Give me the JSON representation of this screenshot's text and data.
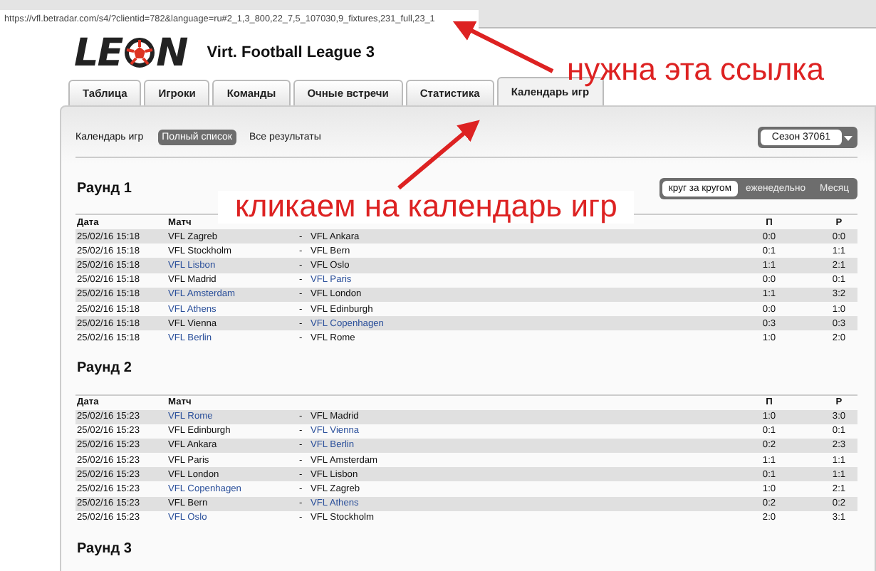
{
  "address_bar": {
    "url": "https://vfl.betradar.com/s4/?clientid=782&language=ru#2_1,3_800,22_7,5_107030,9_fixtures,231_full,23_1"
  },
  "header": {
    "logo_before": "LE",
    "logo_after": "N",
    "title": "Virt. Football League 3"
  },
  "tabs": [
    {
      "label": "Таблица",
      "selected": false
    },
    {
      "label": "Игроки",
      "selected": false
    },
    {
      "label": "Команды",
      "selected": false
    },
    {
      "label": "Очные встречи",
      "selected": false
    },
    {
      "label": "Статистика",
      "selected": false
    },
    {
      "label": "Календарь игр",
      "selected": true
    }
  ],
  "subnav": {
    "label": "Календарь игр",
    "items": [
      {
        "label": "Полный список",
        "selected": true
      },
      {
        "label": "Все результаты",
        "selected": false
      }
    ],
    "season": "Сезон 37061"
  },
  "view_toggle": [
    {
      "label": "круг за кругом",
      "selected": true
    },
    {
      "label": "еженедельно",
      "selected": false
    },
    {
      "label": "Месяц",
      "selected": false
    }
  ],
  "rounds": [
    {
      "title": "Раунд 1",
      "columns": {
        "date": "Дата",
        "match": "Матч",
        "col_p": "П",
        "col_r": "Р"
      },
      "matches": [
        {
          "date": "25/02/16 15:18",
          "home": "VFL Zagreb",
          "sep": "-",
          "away": "VFL Ankara",
          "p": "0:0",
          "r": "0:0",
          "home_won": false,
          "away_won": false
        },
        {
          "date": "25/02/16 15:18",
          "home": "VFL Stockholm",
          "sep": "-",
          "away": "VFL Bern",
          "p": "0:1",
          "r": "1:1",
          "home_won": false,
          "away_won": false
        },
        {
          "date": "25/02/16 15:18",
          "home": "VFL Lisbon",
          "sep": "-",
          "away": "VFL Oslo",
          "p": "1:1",
          "r": "2:1",
          "home_won": true,
          "away_won": false
        },
        {
          "date": "25/02/16 15:18",
          "home": "VFL Madrid",
          "sep": "-",
          "away": "VFL Paris",
          "p": "0:0",
          "r": "0:1",
          "home_won": false,
          "away_won": true
        },
        {
          "date": "25/02/16 15:18",
          "home": "VFL Amsterdam",
          "sep": "-",
          "away": "VFL London",
          "p": "1:1",
          "r": "3:2",
          "home_won": true,
          "away_won": false
        },
        {
          "date": "25/02/16 15:18",
          "home": "VFL Athens",
          "sep": "-",
          "away": "VFL Edinburgh",
          "p": "0:0",
          "r": "1:0",
          "home_won": true,
          "away_won": false
        },
        {
          "date": "25/02/16 15:18",
          "home": "VFL Vienna",
          "sep": "-",
          "away": "VFL Copenhagen",
          "p": "0:3",
          "r": "0:3",
          "home_won": false,
          "away_won": true
        },
        {
          "date": "25/02/16 15:18",
          "home": "VFL Berlin",
          "sep": "-",
          "away": "VFL Rome",
          "p": "1:0",
          "r": "2:0",
          "home_won": true,
          "away_won": false
        }
      ]
    },
    {
      "title": "Раунд 2",
      "columns": {
        "date": "Дата",
        "match": "Матч",
        "col_p": "П",
        "col_r": "Р"
      },
      "matches": [
        {
          "date": "25/02/16 15:23",
          "home": "VFL Rome",
          "sep": "-",
          "away": "VFL Madrid",
          "p": "1:0",
          "r": "3:0",
          "home_won": true,
          "away_won": false
        },
        {
          "date": "25/02/16 15:23",
          "home": "VFL Edinburgh",
          "sep": "-",
          "away": "VFL Vienna",
          "p": "0:1",
          "r": "0:1",
          "home_won": false,
          "away_won": true
        },
        {
          "date": "25/02/16 15:23",
          "home": "VFL Ankara",
          "sep": "-",
          "away": "VFL Berlin",
          "p": "0:2",
          "r": "2:3",
          "home_won": false,
          "away_won": true
        },
        {
          "date": "25/02/16 15:23",
          "home": "VFL Paris",
          "sep": "-",
          "away": "VFL Amsterdam",
          "p": "1:1",
          "r": "1:1",
          "home_won": false,
          "away_won": false
        },
        {
          "date": "25/02/16 15:23",
          "home": "VFL London",
          "sep": "-",
          "away": "VFL Lisbon",
          "p": "0:1",
          "r": "1:1",
          "home_won": false,
          "away_won": false
        },
        {
          "date": "25/02/16 15:23",
          "home": "VFL Copenhagen",
          "sep": "-",
          "away": "VFL Zagreb",
          "p": "1:0",
          "r": "2:1",
          "home_won": true,
          "away_won": false
        },
        {
          "date": "25/02/16 15:23",
          "home": "VFL Bern",
          "sep": "-",
          "away": "VFL Athens",
          "p": "0:2",
          "r": "0:2",
          "home_won": false,
          "away_won": true
        },
        {
          "date": "25/02/16 15:23",
          "home": "VFL Oslo",
          "sep": "-",
          "away": "VFL Stockholm",
          "p": "2:0",
          "r": "3:1",
          "home_won": true,
          "away_won": false
        }
      ]
    },
    {
      "title": "Раунд 3"
    }
  ],
  "annotations": [
    {
      "kind": "plain",
      "text": "нужна эта ссылка"
    },
    {
      "kind": "boxed",
      "text": "кликаем на календарь игр"
    }
  ]
}
